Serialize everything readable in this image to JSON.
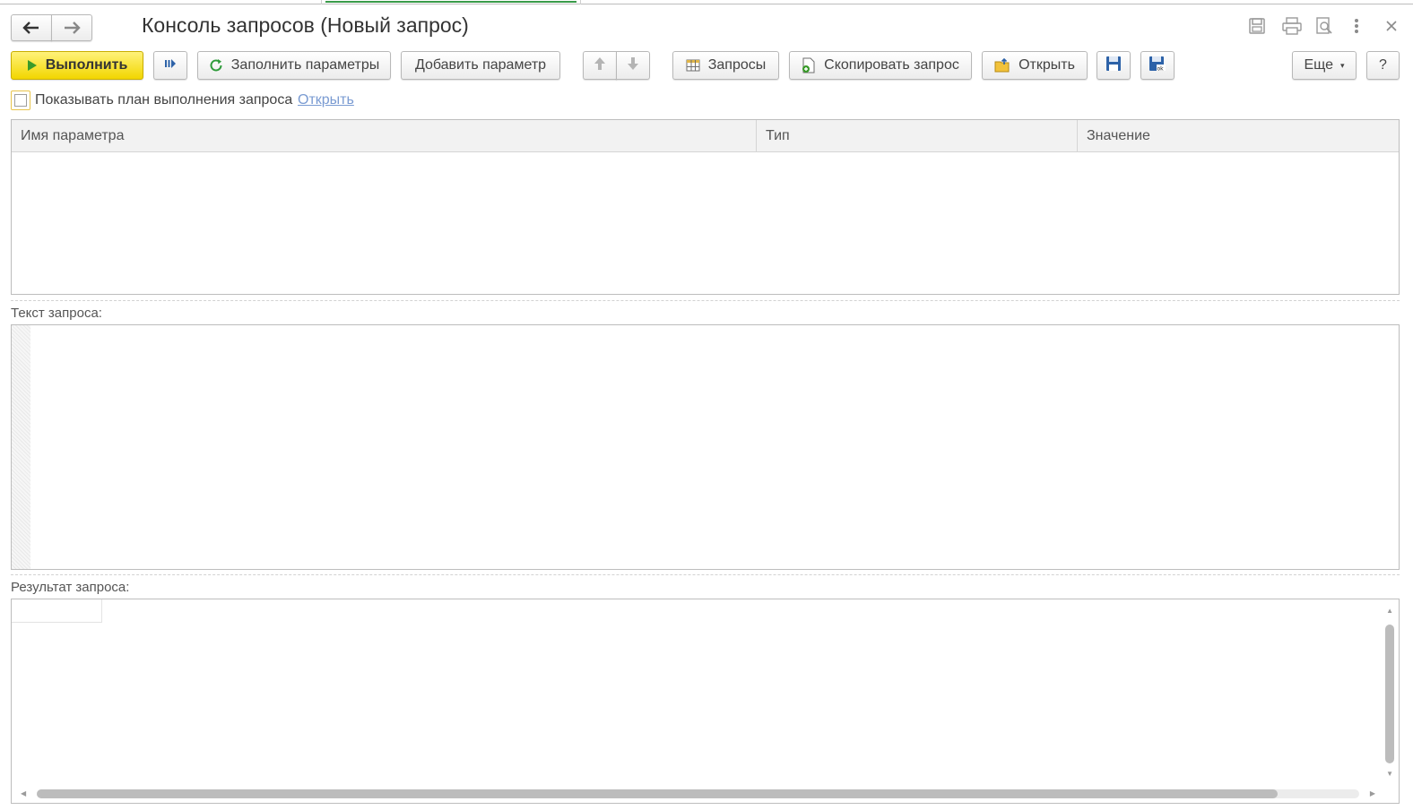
{
  "window": {
    "title": "Консоль запросов (Новый запрос)",
    "icons": [
      "save-icon",
      "print-icon",
      "preview-icon",
      "more-vertical-icon",
      "close-icon"
    ]
  },
  "nav": {
    "back_icon": "arrow-left-icon",
    "forward_icon": "arrow-right-icon"
  },
  "toolbar": {
    "execute_label": "Выполнить",
    "fill_params_label": "Заполнить параметры",
    "add_param_label": "Добавить параметр",
    "queries_label": "Запросы",
    "copy_query_label": "Скопировать запрос",
    "open_label": "Открыть",
    "more_label": "Еще",
    "help_label": "?"
  },
  "options": {
    "show_plan_label": "Показывать план выполнения запроса",
    "show_plan_checked": false,
    "open_link": "Открыть"
  },
  "params_table": {
    "columns": [
      "Имя параметра",
      "Тип",
      "Значение"
    ],
    "rows": []
  },
  "query_text": {
    "label": "Текст запроса:",
    "value": ""
  },
  "query_result": {
    "label": "Результат запроса:"
  },
  "colors": {
    "primary_button": "#f2d600",
    "accent_tab": "#3a9b4a",
    "link": "#7a9bd2"
  }
}
